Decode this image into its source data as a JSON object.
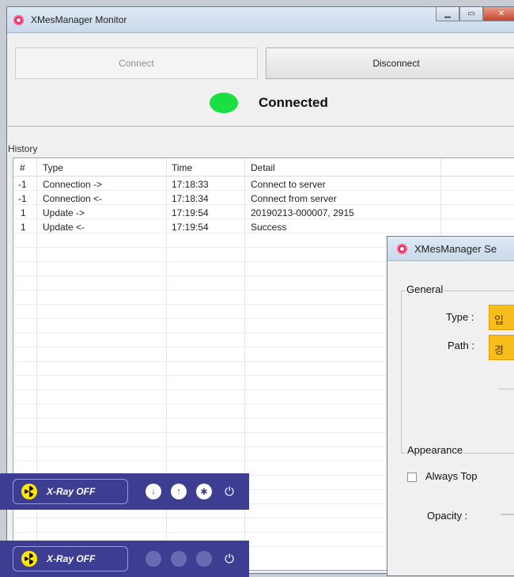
{
  "monitor": {
    "title": "XMesManager Monitor",
    "buttons": {
      "connect": "Connect",
      "disconnect": "Disconnect"
    },
    "status": {
      "text": "Connected",
      "color": "#19e040"
    },
    "history_label": "History",
    "columns": [
      "#",
      "Type",
      "Time",
      "Detail"
    ],
    "rows": [
      {
        "num": "-1",
        "type": "Connection ->",
        "time": "17:18:33",
        "detail": "Connect to server"
      },
      {
        "num": "-1",
        "type": "Connection <-",
        "time": "17:18:34",
        "detail": "Connect from server"
      },
      {
        "num": "1",
        "type": "Update ->",
        "time": "17:19:54",
        "detail": "20190213-000007, 2915"
      },
      {
        "num": "1",
        "type": "Update <-",
        "time": "17:19:54",
        "detail": "Success"
      }
    ]
  },
  "settings": {
    "title": "XMesManager Se",
    "general_label": "General",
    "type_label": "Type :",
    "type_value": "입",
    "path_label": "Path :",
    "path_value": "경",
    "appearance_label": "Appearance",
    "always_top_label": "Always Top",
    "opacity_label": "Opacity :"
  },
  "overlays": [
    {
      "label": "X-Ray OFF",
      "icons": [
        "download-icon",
        "upload-icon",
        "gear-icon",
        "power-icon"
      ],
      "enabled": true
    },
    {
      "label": "X-Ray OFF",
      "icons": [
        "download-icon",
        "upload-icon",
        "gear-icon",
        "power-icon"
      ],
      "enabled": false
    }
  ],
  "colors": {
    "accent_yellow": "#f7bd1d",
    "overlay_bg": "#3d3d92",
    "status_green": "#19e040"
  }
}
